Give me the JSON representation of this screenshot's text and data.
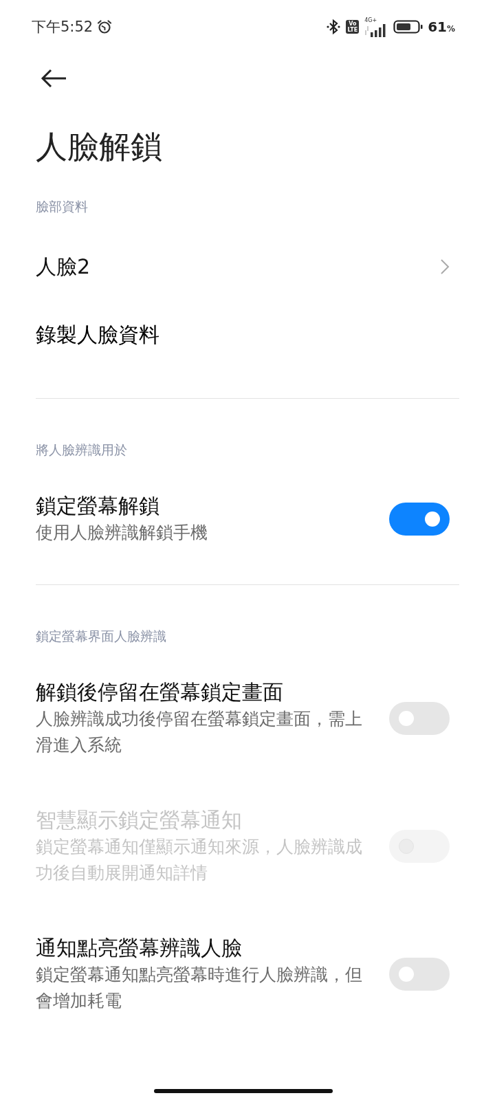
{
  "status_bar": {
    "time": "下午5:52",
    "volte": [
      "Vo",
      "LTE"
    ],
    "network": "4G+",
    "battery_percent": "61",
    "percent_sign": "%"
  },
  "page": {
    "title": "人臉解鎖"
  },
  "sections": [
    {
      "header": "臉部資料",
      "items": [
        {
          "kind": "nav",
          "title": "人臉2"
        },
        {
          "kind": "action",
          "title": "錄製人臉資料"
        }
      ]
    },
    {
      "header": "將人臉辨識用於",
      "items": [
        {
          "kind": "toggle",
          "title": "鎖定螢幕解鎖",
          "subtitle": "使用人臉辨識解鎖手機",
          "on": true,
          "disabled": false
        }
      ]
    },
    {
      "header": "鎖定螢幕界面人臉辨識",
      "items": [
        {
          "kind": "toggle",
          "title": "解鎖後停留在螢幕鎖定畫面",
          "subtitle": "人臉辨識成功後停留在螢幕鎖定畫面，需上滑進入系統",
          "on": false,
          "disabled": false
        },
        {
          "kind": "toggle",
          "title": "智慧顯示鎖定螢幕通知",
          "subtitle": "鎖定螢幕通知僅顯示通知來源，人臉辨識成功後自動展開通知詳情",
          "on": false,
          "disabled": true
        },
        {
          "kind": "toggle",
          "title": "通知點亮螢幕辨識人臉",
          "subtitle": "鎖定螢幕通知點亮螢幕時進行人臉辨識，但會增加耗電",
          "on": false,
          "disabled": false
        }
      ]
    }
  ]
}
